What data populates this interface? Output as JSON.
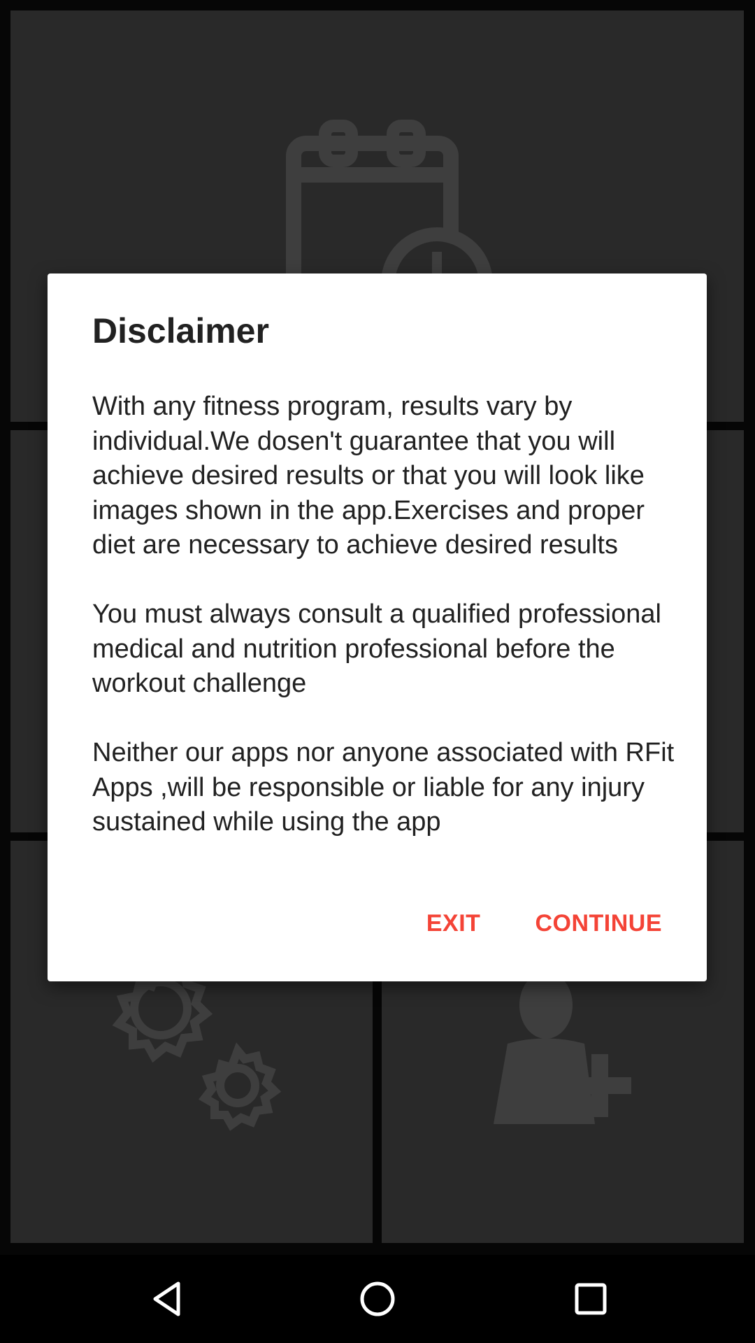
{
  "dialog": {
    "title": "Disclaimer",
    "paragraphs": [
      "With any fitness program, results vary by individual.We dosen't guarantee that you will achieve desired results or that you will look like images shown in the app.Exercises and proper diet are necessary to achieve desired results",
      "You must always consult a qualified professional medical and nutrition professional before the workout challenge",
      "Neither our apps nor anyone associated with RFit Apps ,will be responsible or liable for any injury sustained while using the app"
    ],
    "exit_label": "EXIT",
    "continue_label": "CONTINUE"
  },
  "background_tiles": [
    {
      "icon": "calendar-clock-icon"
    },
    {
      "icon": "blank"
    },
    {
      "icon": "blank"
    },
    {
      "icon": "blank"
    },
    {
      "icon": "gears-icon"
    },
    {
      "icon": "add-user-icon"
    }
  ],
  "navbar": {
    "back_icon": "back-triangle-icon",
    "home_icon": "home-circle-icon",
    "recents_icon": "recents-square-icon"
  },
  "colors": {
    "accent": "#f44336",
    "dialog_bg": "#ffffff",
    "tile_bg": "#5c5c5c",
    "navbar_bg": "#000000"
  }
}
